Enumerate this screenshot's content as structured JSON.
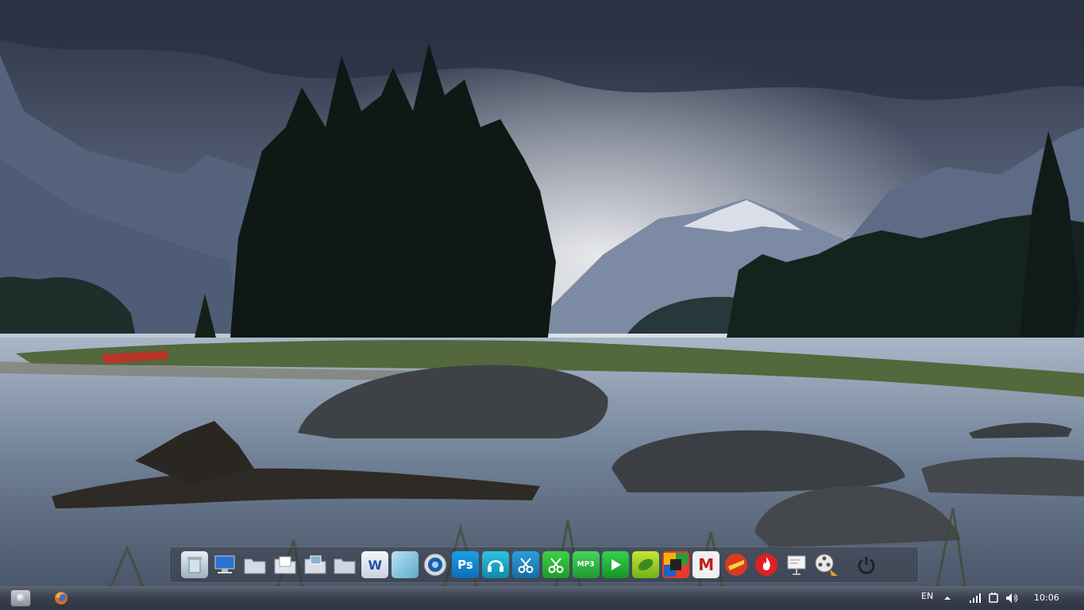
{
  "desktop": {
    "wallpaper": "Lake with mountains, pine trees and rocks"
  },
  "dock": {
    "items": [
      {
        "name": "recycle-bin-icon",
        "label": ""
      },
      {
        "name": "computer-icon",
        "label": ""
      },
      {
        "name": "folder-icon",
        "label": ""
      },
      {
        "name": "documents-folder-icon",
        "label": ""
      },
      {
        "name": "pictures-folder-icon",
        "label": ""
      },
      {
        "name": "folder-icon-2",
        "label": ""
      },
      {
        "name": "word-icon",
        "label": "W"
      },
      {
        "name": "file-icon",
        "label": ""
      },
      {
        "name": "media-player-icon",
        "label": ""
      },
      {
        "name": "photoshop-icon",
        "label": "Ps"
      },
      {
        "name": "headphones-icon",
        "label": ""
      },
      {
        "name": "scissors-icon",
        "label": ""
      },
      {
        "name": "scissors-icon-2",
        "label": ""
      },
      {
        "name": "mp3-icon",
        "label": "MP3"
      },
      {
        "name": "play-icon",
        "label": ""
      },
      {
        "name": "pea-icon",
        "label": ""
      },
      {
        "name": "color-blocks-icon",
        "label": ""
      },
      {
        "name": "m-logo-icon",
        "label": "M"
      },
      {
        "name": "ccleaner-icon",
        "label": ""
      },
      {
        "name": "flame-icon",
        "label": ""
      },
      {
        "name": "presentation-icon",
        "label": ""
      },
      {
        "name": "film-reel-icon",
        "label": ""
      },
      {
        "name": "power-icon",
        "label": ""
      }
    ]
  },
  "taskbar": {
    "language": "EN",
    "clock": "10:06"
  }
}
